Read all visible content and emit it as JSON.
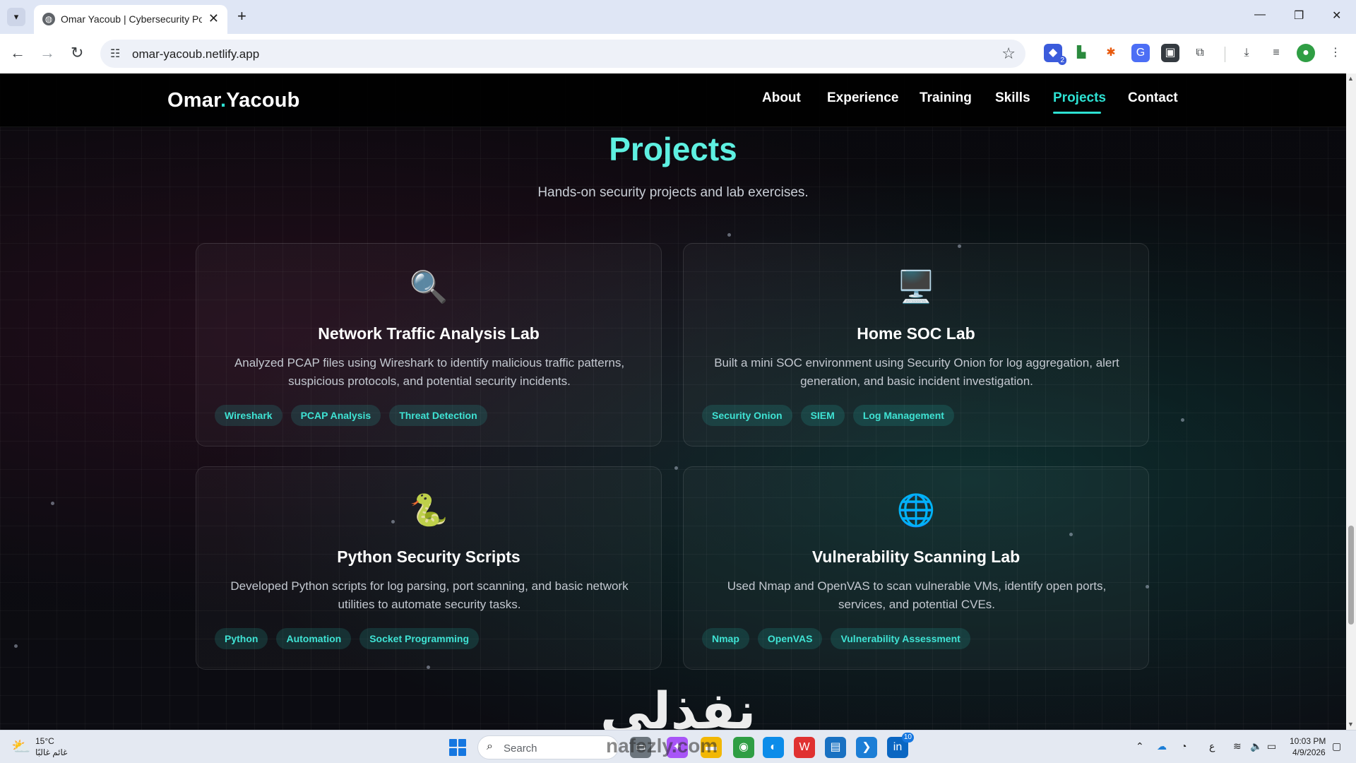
{
  "browser": {
    "tab_title": "Omar Yacoub | Cybersecurity Portfolio",
    "url": "omar-yacoub.netlify.app",
    "extension_badge": "2"
  },
  "site": {
    "logo_first": "Omar",
    "logo_dot": ".",
    "logo_last": "Yacoub",
    "nav": [
      {
        "label": "About"
      },
      {
        "label": "Experience"
      },
      {
        "label": "Training"
      },
      {
        "label": "Skills"
      },
      {
        "label": "Projects"
      },
      {
        "label": "Contact"
      }
    ],
    "active_nav": "Projects"
  },
  "projects": {
    "title": "Projects",
    "subtitle": "Hands-on security projects and lab exercises.",
    "cards": [
      {
        "icon": "magnifier-icon",
        "icon_glyph": "🔍",
        "title": "Network Traffic Analysis Lab",
        "description": "Analyzed PCAP files using Wireshark to identify malicious traffic patterns, suspicious protocols, and potential security incidents.",
        "tags": [
          "Wireshark",
          "PCAP Analysis",
          "Threat Detection"
        ]
      },
      {
        "icon": "desktop-computer-icon",
        "icon_glyph": "🖥️",
        "title": "Home SOC Lab",
        "description": "Built a mini SOC environment using Security Onion for log aggregation, alert generation, and basic incident investigation.",
        "tags": [
          "Security Onion",
          "SIEM",
          "Log Management"
        ]
      },
      {
        "icon": "python-snake-icon",
        "icon_glyph": "🐍",
        "title": "Python Security Scripts",
        "description": "Developed Python scripts for log parsing, port scanning, and basic network utilities to automate security tasks.",
        "tags": [
          "Python",
          "Automation",
          "Socket Programming"
        ]
      },
      {
        "icon": "globe-icon",
        "icon_glyph": "🌐",
        "title": "Vulnerability Scanning Lab",
        "description": "Used Nmap and OpenVAS to scan vulnerable VMs, identify open ports, services, and potential CVEs.",
        "tags": [
          "Nmap",
          "OpenVAS",
          "Vulnerability Assessment"
        ]
      }
    ]
  },
  "watermark": "نفذلي",
  "watermark_site": "nafezly.com",
  "taskbar": {
    "weather_temp": "15°C",
    "weather_desc": "غائم غالبًا",
    "search_placeholder": "Search",
    "linkedin_badge": "10",
    "tray_lang": "ع",
    "time": "10:03 PM",
    "date": "4/9/2026"
  }
}
